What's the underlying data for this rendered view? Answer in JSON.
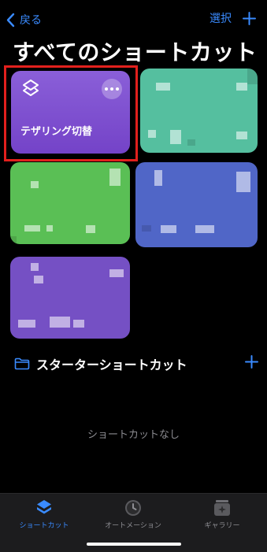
{
  "nav": {
    "back_label": "戻る",
    "select_label": "選択"
  },
  "page_title": "すべてのショートカット",
  "shortcuts": [
    {
      "title": "テザリング切替",
      "color": "#7a4cd0"
    },
    {
      "title": "",
      "color": "#55bf9f"
    },
    {
      "title": "",
      "color": "#5abf55"
    },
    {
      "title": "",
      "color": "#5066c7"
    },
    {
      "title": "",
      "color": "#7550c4"
    }
  ],
  "starter_section": {
    "title": "スターターショートカット",
    "empty_text": "ショートカットなし"
  },
  "tabbar": {
    "tabs": [
      {
        "label": "ショートカット",
        "icon": "layers-icon",
        "active": true
      },
      {
        "label": "オートメーション",
        "icon": "clock-icon",
        "active": false
      },
      {
        "label": "ギャラリー",
        "icon": "gallery-icon",
        "active": false
      }
    ]
  },
  "colors": {
    "accent": "#3a8bff",
    "highlight": "#e2201d"
  }
}
